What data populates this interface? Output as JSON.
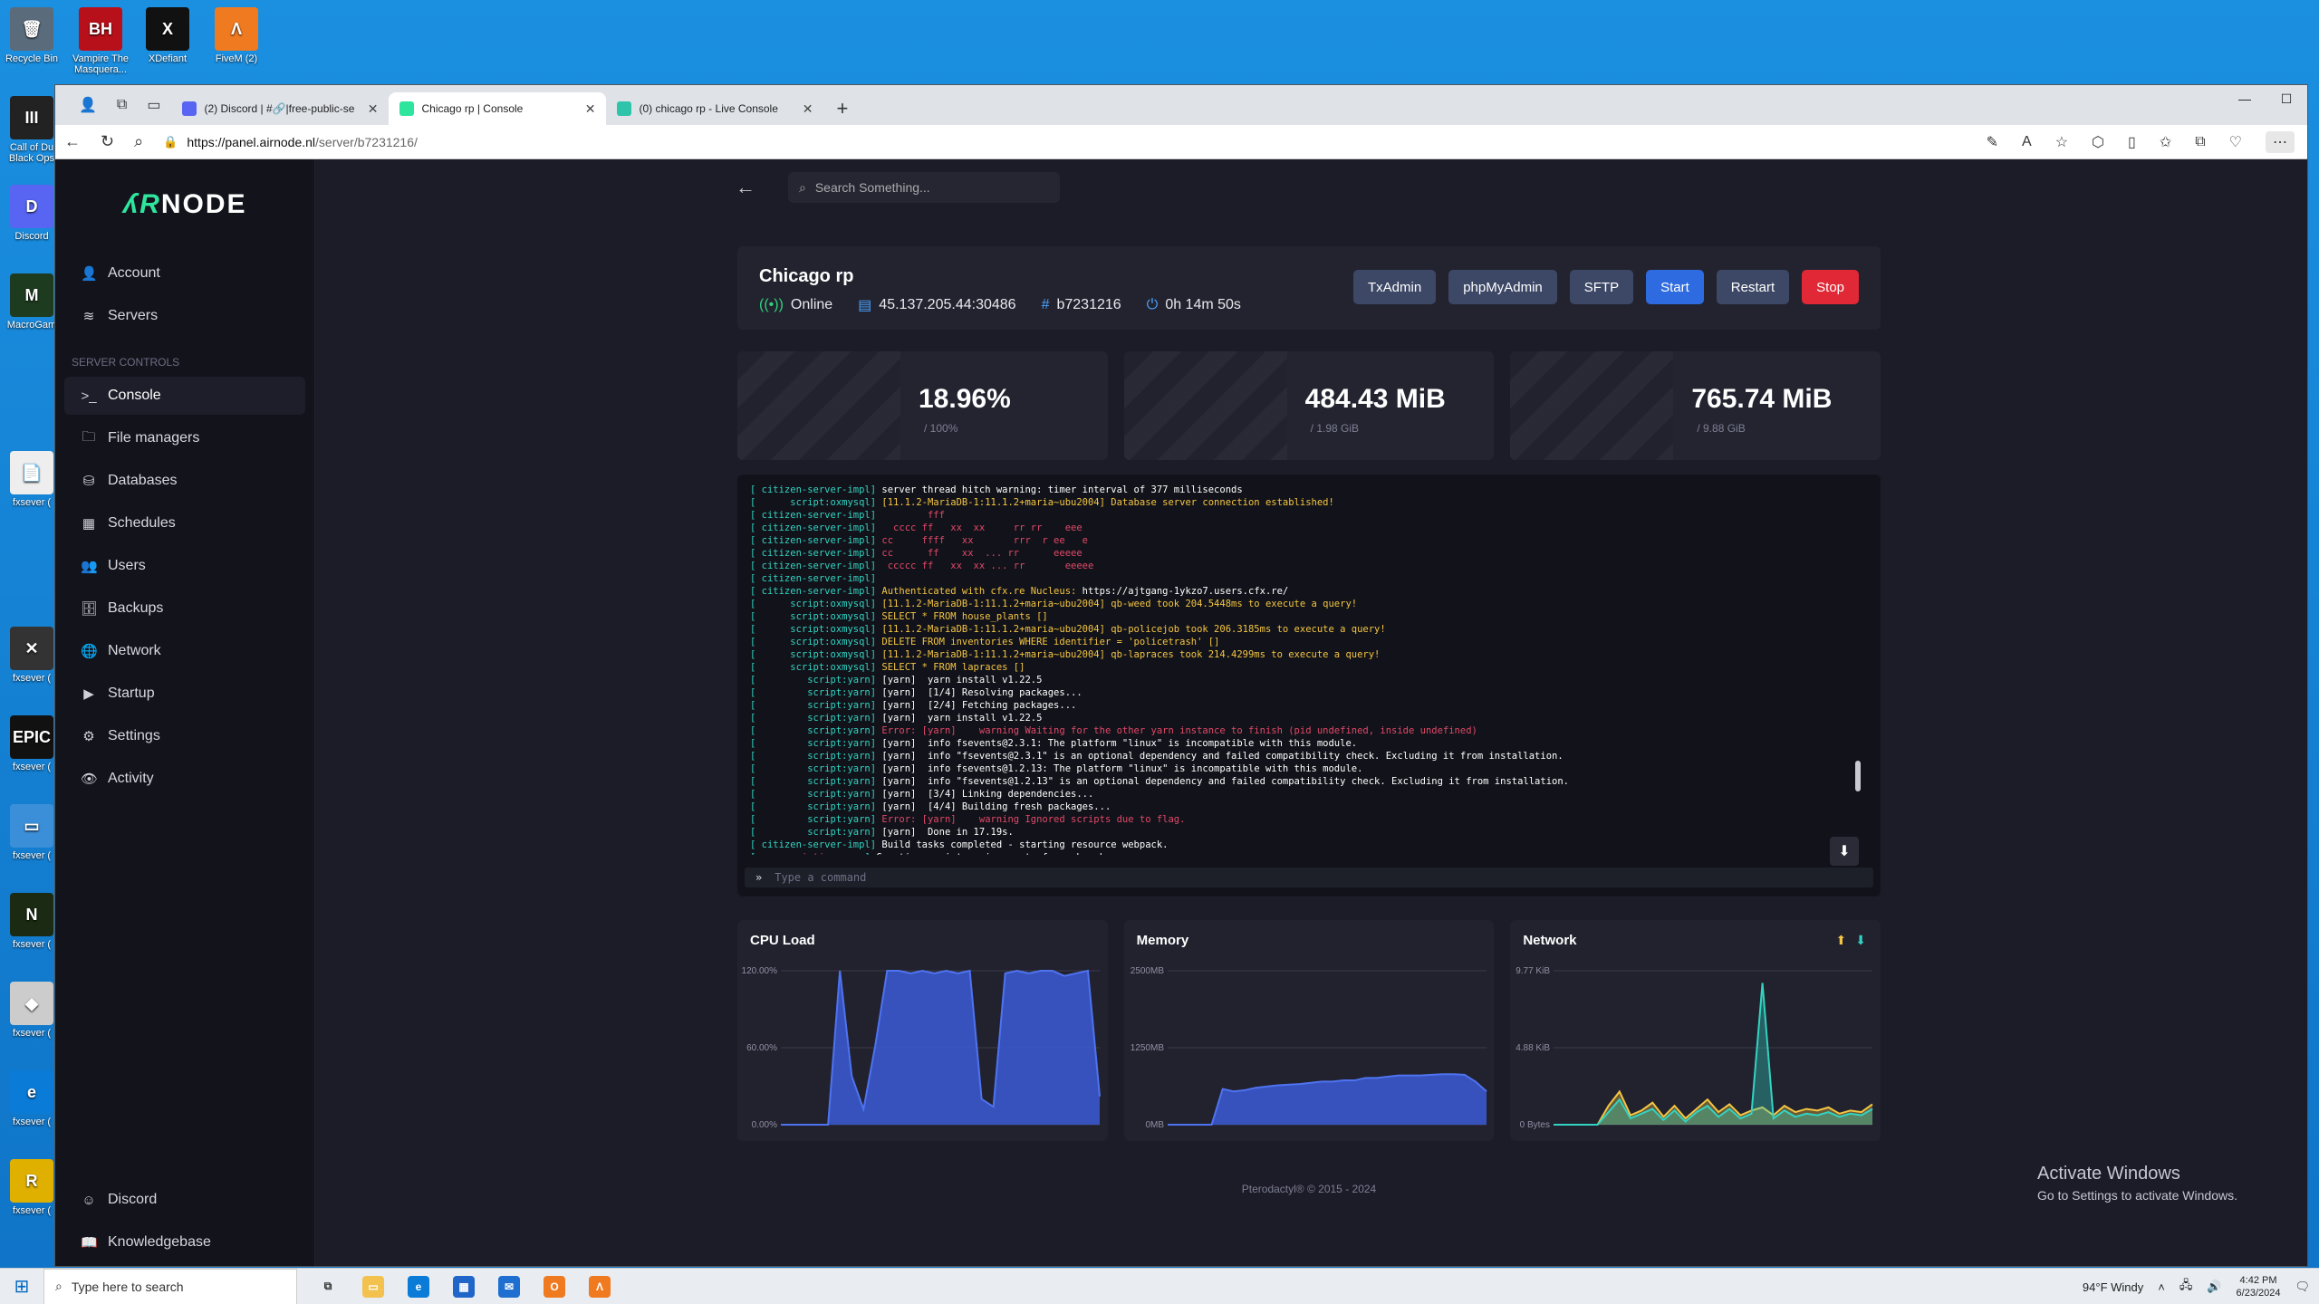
{
  "desktop_icons": [
    {
      "label": "Recycle Bin",
      "color": "#5a6b7c",
      "glyph": "🗑"
    },
    {
      "label": "Vampire The Masquera...",
      "color": "#b8101a",
      "glyph": "BH"
    },
    {
      "label": "XDefiant",
      "color": "#111111",
      "glyph": "X"
    },
    {
      "label": "FiveM (2)",
      "color": "#f07a20",
      "glyph": "Λ"
    },
    {
      "label": "Call of Du Black Ops",
      "color": "#222222",
      "glyph": "III"
    },
    {
      "label": "Discord",
      "color": "#5865f2",
      "glyph": "D"
    },
    {
      "label": "MacroGam",
      "color": "#1d3b1f",
      "glyph": "M"
    },
    {
      "label": "fxsever (",
      "color": "#eeeeee",
      "glyph": "📄"
    },
    {
      "label": "fxsever (",
      "color": "#333333",
      "glyph": "✕"
    },
    {
      "label": "fxsever (",
      "color": "#111111",
      "glyph": "EPIC"
    },
    {
      "label": "fxsever (",
      "color": "#3b8fd8",
      "glyph": "▭"
    },
    {
      "label": "fxsever (",
      "color": "#1b2a12",
      "glyph": "N"
    },
    {
      "label": "fxsever (",
      "color": "#cccccc",
      "glyph": "◆"
    },
    {
      "label": "fxsever (",
      "color": "#0a7bd6",
      "glyph": "e"
    },
    {
      "label": "fxsever (",
      "color": "#e0b000",
      "glyph": "R"
    }
  ],
  "browser": {
    "tabs": [
      {
        "title": "(2) Discord | #🔗|free-public-se",
        "fav_color": "#5865f2",
        "active": false
      },
      {
        "title": "Chicago rp | Console",
        "fav_color": "#2ee59d",
        "active": true
      },
      {
        "title": "(0) chicago rp - Live Console",
        "fav_color": "#2ec4a9",
        "active": false
      }
    ],
    "url_host": "https://panel.airnode.nl",
    "url_path": "/server/b7231216/"
  },
  "panel": {
    "logo_prefix": "ʎR",
    "logo_suffix": "NODE",
    "nav_top": [
      {
        "label": "Account",
        "icon": "👤"
      },
      {
        "label": "Servers",
        "icon": "≋"
      }
    ],
    "section_title": "SERVER CONTROLS",
    "nav_server": [
      {
        "label": "Console",
        "icon": ">_",
        "active": true
      },
      {
        "label": "File managers",
        "icon": "🗀"
      },
      {
        "label": "Databases",
        "icon": "⛁"
      },
      {
        "label": "Schedules",
        "icon": "▦"
      },
      {
        "label": "Users",
        "icon": "👥"
      },
      {
        "label": "Backups",
        "icon": "🗄"
      },
      {
        "label": "Network",
        "icon": "🌐"
      },
      {
        "label": "Startup",
        "icon": "▶"
      },
      {
        "label": "Settings",
        "icon": "⚙"
      },
      {
        "label": "Activity",
        "icon": "👁"
      }
    ],
    "nav_bottom": [
      {
        "label": "Discord",
        "icon": "☺"
      },
      {
        "label": "Knowledgebase",
        "icon": "📖"
      }
    ],
    "search_placeholder": "Search Something...",
    "server": {
      "name": "Chicago rp",
      "status": "Online",
      "address": "45.137.205.44:30486",
      "id": "b7231216",
      "uptime": "0h 14m 50s"
    },
    "buttons": {
      "txadmin": "TxAdmin",
      "phpmyadmin": "phpMyAdmin",
      "sftp": "SFTP",
      "start": "Start",
      "restart": "Restart",
      "stop": "Stop"
    },
    "stats": [
      {
        "value": "18.96%",
        "limit": "/ 100%"
      },
      {
        "value": "484.43 MiB",
        "limit": "/ 1.98 GiB"
      },
      {
        "value": "765.74 MiB",
        "limit": "/ 9.88 GiB"
      }
    ],
    "console_lines": [
      [
        [
          "p",
          "[ citizen-server-impl] "
        ],
        [
          "w",
          "server thread hitch warning: timer interval of 377 milliseconds"
        ]
      ],
      [
        [
          "p",
          "[      script:oxmysql] "
        ],
        [
          "y",
          "[11.1.2-MariaDB-1:11.1.2+maria~ubu2004] Database server connection established!"
        ]
      ],
      [
        [
          "p",
          "[ citizen-server-impl] "
        ],
        [
          "r",
          "        fff"
        ]
      ],
      [
        [
          "p",
          "[ citizen-server-impl] "
        ],
        [
          "r",
          "  cccc ff   xx  xx     rr rr    eee"
        ]
      ],
      [
        [
          "p",
          "[ citizen-server-impl] "
        ],
        [
          "r",
          "cc     ffff   xx       rrr  r ee   e"
        ]
      ],
      [
        [
          "p",
          "[ citizen-server-impl] "
        ],
        [
          "r",
          "cc      ff    xx  ... rr      eeeee"
        ]
      ],
      [
        [
          "p",
          "[ citizen-server-impl] "
        ],
        [
          "r",
          " ccccc ff   xx  xx ... rr       eeeee"
        ]
      ],
      [
        [
          "p",
          "[ citizen-server-impl] "
        ]
      ],
      [
        [
          "p",
          "[ citizen-server-impl] "
        ],
        [
          "y",
          "Authenticated with cfx.re Nucleus: "
        ],
        [
          "w",
          "https://ajtgang-1ykzo7.users.cfx.re/"
        ]
      ],
      [
        [
          "p",
          "[      script:oxmysql] "
        ],
        [
          "y",
          "[11.1.2-MariaDB-1:11.1.2+maria~ubu2004] qb-weed took 204.5448ms to execute a query!"
        ]
      ],
      [
        [
          "p",
          "[      script:oxmysql] "
        ],
        [
          "y",
          "SELECT * FROM house_plants []"
        ]
      ],
      [
        [
          "p",
          "[      script:oxmysql] "
        ],
        [
          "y",
          "[11.1.2-MariaDB-1:11.1.2+maria~ubu2004] qb-policejob took 206.3185ms to execute a query!"
        ]
      ],
      [
        [
          "p",
          "[      script:oxmysql] "
        ],
        [
          "y",
          "DELETE FROM inventories WHERE identifier = 'policetrash' []"
        ]
      ],
      [
        [
          "p",
          "[      script:oxmysql] "
        ],
        [
          "y",
          "[11.1.2-MariaDB-1:11.1.2+maria~ubu2004] qb-lapraces took 214.4299ms to execute a query!"
        ]
      ],
      [
        [
          "p",
          "[      script:oxmysql] "
        ],
        [
          "y",
          "SELECT * FROM lapraces []"
        ]
      ],
      [
        [
          "p",
          "[         script:yarn] "
        ],
        [
          "w",
          "[yarn]  yarn install v1.22.5"
        ]
      ],
      [
        [
          "p",
          "[         script:yarn] "
        ],
        [
          "w",
          "[yarn]  [1/4] Resolving packages..."
        ]
      ],
      [
        [
          "p",
          "[         script:yarn] "
        ],
        [
          "w",
          "[yarn]  [2/4] Fetching packages..."
        ]
      ],
      [
        [
          "p",
          "[         script:yarn] "
        ],
        [
          "w",
          "[yarn]  yarn install v1.22.5"
        ]
      ],
      [
        [
          "p",
          "[         script:yarn] "
        ],
        [
          "r",
          "Error: [yarn]    warning Waiting for the other yarn instance to finish (pid undefined, inside undefined)"
        ]
      ],
      [
        [
          "p",
          "[         script:yarn] "
        ],
        [
          "w",
          "[yarn]  info fsevents@2.3.1: The platform \"linux\" is incompatible with this module."
        ]
      ],
      [
        [
          "p",
          "[         script:yarn] "
        ],
        [
          "w",
          "[yarn]  info \"fsevents@2.3.1\" is an optional dependency and failed compatibility check. Excluding it from installation."
        ]
      ],
      [
        [
          "p",
          "[         script:yarn] "
        ],
        [
          "w",
          "[yarn]  info fsevents@1.2.13: The platform \"linux\" is incompatible with this module."
        ]
      ],
      [
        [
          "p",
          "[         script:yarn] "
        ],
        [
          "w",
          "[yarn]  info \"fsevents@1.2.13\" is an optional dependency and failed compatibility check. Excluding it from installation."
        ]
      ],
      [
        [
          "p",
          "[         script:yarn] "
        ],
        [
          "w",
          "[yarn]  [3/4] Linking dependencies..."
        ]
      ],
      [
        [
          "p",
          "[         script:yarn] "
        ],
        [
          "w",
          "[yarn]  [4/4] Building fresh packages..."
        ]
      ],
      [
        [
          "p",
          "[         script:yarn] "
        ],
        [
          "r",
          "Error: [yarn]    warning Ignored scripts due to flag."
        ]
      ],
      [
        [
          "p",
          "[         script:yarn] "
        ],
        [
          "w",
          "[yarn]  Done in 17.19s."
        ]
      ],
      [
        [
          "p",
          "[ citizen-server-impl] "
        ],
        [
          "w",
          "Build tasks completed - starting resource webpack."
        ]
      ],
      [
        [
          "p",
          "[   "
        ],
        [
          "r",
          "c-scripting-core"
        ],
        [
          "p",
          "] "
        ],
        [
          "w",
          "Creating script environments for webpack"
        ]
      ]
    ],
    "command_placeholder": "Type a command",
    "charts": {
      "cpu": {
        "title": "CPU Load",
        "yticks": [
          "120.00%",
          "60.00%",
          "0.00%"
        ],
        "ymax": 120,
        "values": [
          0,
          0,
          0,
          0,
          0,
          120,
          38,
          12,
          62,
          120,
          120,
          118,
          120,
          118,
          120,
          118,
          120,
          20,
          14,
          118,
          120,
          118,
          120,
          120,
          116,
          118,
          120,
          22
        ]
      },
      "memory": {
        "title": "Memory",
        "yticks": [
          "2500MB",
          "1250MB",
          "0MB"
        ],
        "ymax": 2500,
        "values": [
          0,
          0,
          0,
          0,
          0,
          580,
          540,
          560,
          600,
          620,
          640,
          650,
          660,
          680,
          700,
          700,
          720,
          720,
          760,
          760,
          780,
          800,
          800,
          800,
          810,
          820,
          820,
          810,
          700,
          540
        ]
      },
      "network": {
        "title": "Network",
        "yticks": [
          "9.77 KiB",
          "4.88 KiB",
          "0 Bytes"
        ],
        "ymax": 9.77,
        "series": [
          {
            "color": "#f4c542",
            "values": [
              0,
              0,
              0,
              0,
              0,
              1.2,
              2.1,
              0.6,
              0.9,
              1.4,
              0.5,
              1.2,
              0.4,
              1.0,
              1.6,
              0.8,
              1.3,
              0.6,
              0.9,
              1.1,
              0.6,
              1.2,
              0.8,
              1.0,
              0.9,
              1.1,
              0.7,
              0.9,
              0.8,
              1.3
            ]
          },
          {
            "color": "#32d3c2",
            "values": [
              0,
              0,
              0,
              0,
              0,
              0.8,
              1.6,
              0.4,
              0.7,
              1.0,
              0.3,
              0.9,
              0.2,
              0.8,
              1.2,
              0.5,
              1.0,
              0.4,
              0.7,
              9.0,
              0.4,
              0.9,
              0.5,
              0.7,
              0.6,
              0.8,
              0.5,
              0.7,
              0.6,
              1.0
            ]
          }
        ]
      }
    },
    "footer": "Pterodactyl® © 2015 - 2024"
  },
  "activate": {
    "title": "Activate Windows",
    "sub": "Go to Settings to activate Windows."
  },
  "taskbar": {
    "search_placeholder": "Type here to search",
    "weather": "94°F  Windy",
    "time": "4:42 PM",
    "date": "6/23/2024"
  }
}
